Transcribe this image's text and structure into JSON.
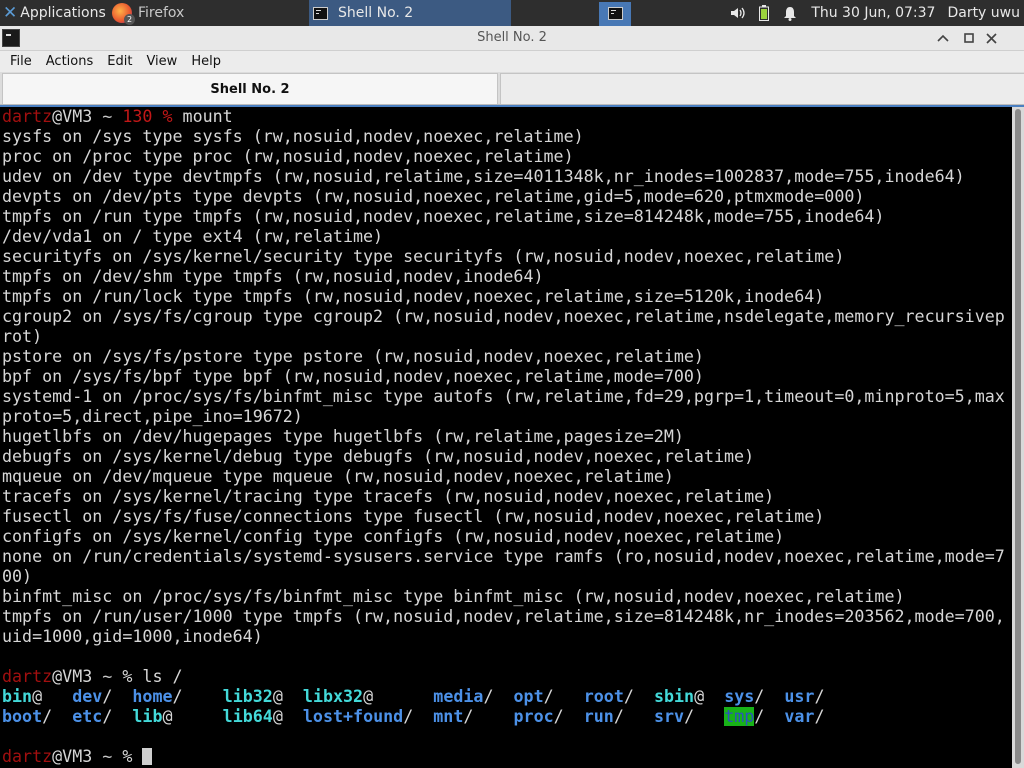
{
  "panel": {
    "apps_label": "Applications",
    "firefox_label": "Firefox",
    "firefox_badge": "2",
    "shell_task_label": "Shell No. 2",
    "clock": "Thu 30 Jun, 07:37",
    "user": "Darty uwu",
    "icons": [
      "xfce-icon",
      "firefox-icon",
      "terminal-icon",
      "volume-icon",
      "battery-icon",
      "notification-bell-icon"
    ]
  },
  "window": {
    "title": "Shell No. 2",
    "menu": [
      "File",
      "Actions",
      "Edit",
      "View",
      "Help"
    ],
    "active_tab": "Shell No. 2"
  },
  "terminal": {
    "prompt1": {
      "user": "dartz",
      "host": "@VM3",
      "cwd": " ~ ",
      "status": "130",
      "sym": " % ",
      "cmd": "mount"
    },
    "output": [
      "sysfs on /sys type sysfs (rw,nosuid,nodev,noexec,relatime)",
      "proc on /proc type proc (rw,nosuid,nodev,noexec,relatime)",
      "udev on /dev type devtmpfs (rw,nosuid,relatime,size=4011348k,nr_inodes=1002837,mode=755,inode64)",
      "devpts on /dev/pts type devpts (rw,nosuid,noexec,relatime,gid=5,mode=620,ptmxmode=000)",
      "tmpfs on /run type tmpfs (rw,nosuid,nodev,noexec,relatime,size=814248k,mode=755,inode64)",
      "/dev/vda1 on / type ext4 (rw,relatime)",
      "securityfs on /sys/kernel/security type securityfs (rw,nosuid,nodev,noexec,relatime)",
      "tmpfs on /dev/shm type tmpfs (rw,nosuid,nodev,inode64)",
      "tmpfs on /run/lock type tmpfs (rw,nosuid,nodev,noexec,relatime,size=5120k,inode64)",
      "cgroup2 on /sys/fs/cgroup type cgroup2 (rw,nosuid,nodev,noexec,relatime,nsdelegate,memory_recursivep",
      "rot)",
      "pstore on /sys/fs/pstore type pstore (rw,nosuid,nodev,noexec,relatime)",
      "bpf on /sys/fs/bpf type bpf (rw,nosuid,nodev,noexec,relatime,mode=700)",
      "systemd-1 on /proc/sys/fs/binfmt_misc type autofs (rw,relatime,fd=29,pgrp=1,timeout=0,minproto=5,max",
      "proto=5,direct,pipe_ino=19672)",
      "hugetlbfs on /dev/hugepages type hugetlbfs (rw,relatime,pagesize=2M)",
      "debugfs on /sys/kernel/debug type debugfs (rw,nosuid,nodev,noexec,relatime)",
      "mqueue on /dev/mqueue type mqueue (rw,nosuid,nodev,noexec,relatime)",
      "tracefs on /sys/kernel/tracing type tracefs (rw,nosuid,nodev,noexec,relatime)",
      "fusectl on /sys/fs/fuse/connections type fusectl (rw,nosuid,nodev,noexec,relatime)",
      "configfs on /sys/kernel/config type configfs (rw,nosuid,nodev,noexec,relatime)",
      "none on /run/credentials/systemd-sysusers.service type ramfs (ro,nosuid,nodev,noexec,relatime,mode=7",
      "00)",
      "binfmt_misc on /proc/sys/fs/binfmt_misc type binfmt_misc (rw,nosuid,nodev,noexec,relatime)",
      "tmpfs on /run/user/1000 type tmpfs (rw,nosuid,nodev,relatime,size=814248k,nr_inodes=203562,mode=700,",
      "uid=1000,gid=1000,inode64)",
      ""
    ],
    "prompt2": {
      "user": "dartz",
      "host": "@VM3",
      "cwd": " ~ ",
      "sym": "% ",
      "cmd": "ls /"
    },
    "ls_rows": [
      [
        {
          "name": "bin",
          "suffix": "@",
          "kind": "link"
        },
        {
          "name": "dev",
          "suffix": "/",
          "kind": "dirbold"
        },
        {
          "name": "home",
          "suffix": "/",
          "kind": "dirbold"
        },
        {
          "name": "lib32",
          "suffix": "@",
          "kind": "link"
        },
        {
          "name": "libx32",
          "suffix": "@",
          "kind": "link"
        },
        {
          "name": "media",
          "suffix": "/",
          "kind": "dirbold"
        },
        {
          "name": "opt",
          "suffix": "/",
          "kind": "dirbold"
        },
        {
          "name": "root",
          "suffix": "/",
          "kind": "dirbold"
        },
        {
          "name": "sbin",
          "suffix": "@",
          "kind": "link"
        },
        {
          "name": "sys",
          "suffix": "/",
          "kind": "dirbold"
        },
        {
          "name": "usr",
          "suffix": "/",
          "kind": "dirbold"
        }
      ],
      [
        {
          "name": "boot",
          "suffix": "/",
          "kind": "dirbold"
        },
        {
          "name": "etc",
          "suffix": "/",
          "kind": "dirbold"
        },
        {
          "name": "lib",
          "suffix": "@",
          "kind": "link"
        },
        {
          "name": "lib64",
          "suffix": "@",
          "kind": "link"
        },
        {
          "name": "lost+found",
          "suffix": "/",
          "kind": "dirbold"
        },
        {
          "name": "mnt",
          "suffix": "/",
          "kind": "dirbold"
        },
        {
          "name": "proc",
          "suffix": "/",
          "kind": "dirbold"
        },
        {
          "name": "run",
          "suffix": "/",
          "kind": "dirbold"
        },
        {
          "name": "srv",
          "suffix": "/",
          "kind": "dirbold"
        },
        {
          "name": "tmp",
          "suffix": "/",
          "kind": "sticky"
        },
        {
          "name": "var",
          "suffix": "/",
          "kind": "dirbold"
        }
      ]
    ],
    "prompt3": {
      "user": "dartz",
      "host": "@VM3",
      "cwd": " ~ ",
      "sym": "% "
    }
  }
}
